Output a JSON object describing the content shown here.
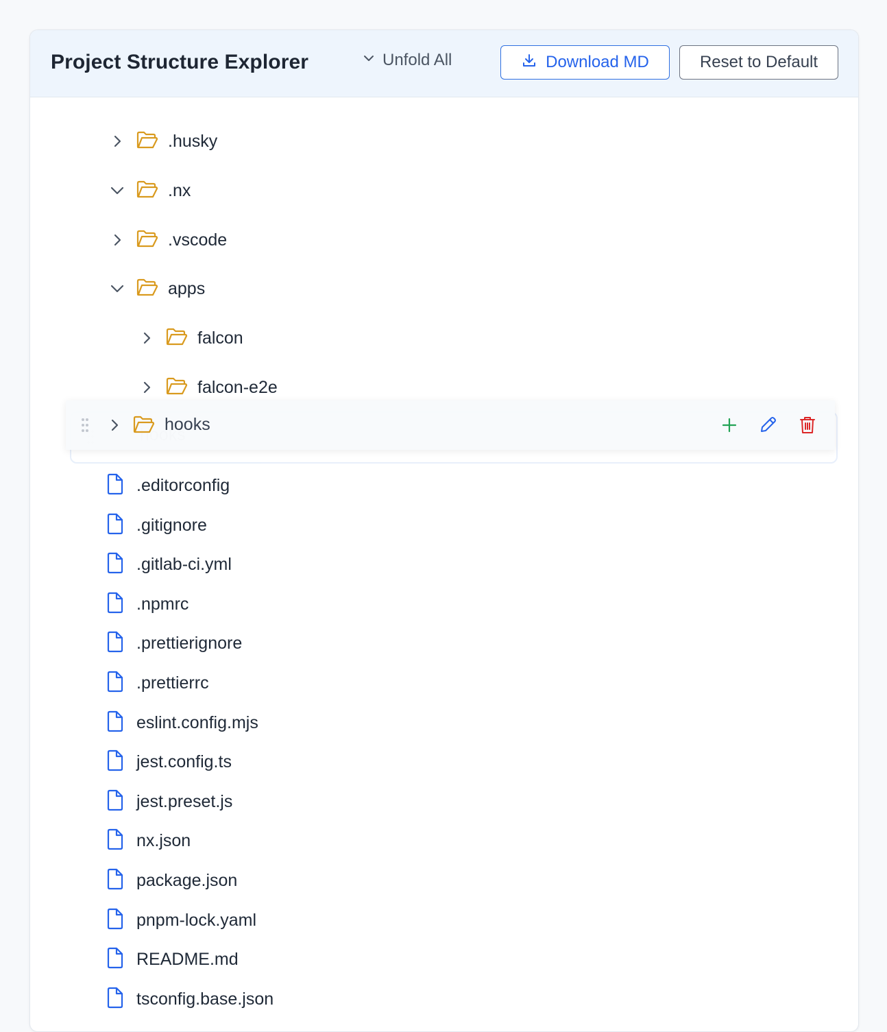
{
  "header": {
    "title": "Project Structure Explorer",
    "unfold_label": "Unfold All",
    "download_label": "Download MD",
    "reset_label": "Reset to Default"
  },
  "tree": {
    "folders": [
      {
        "name": ".husky",
        "expanded": false
      },
      {
        "name": ".nx",
        "expanded": true
      },
      {
        "name": ".vscode",
        "expanded": false
      },
      {
        "name": "apps",
        "expanded": true
      },
      {
        "name": "falcon",
        "expanded": false
      },
      {
        "name": "falcon-e2e",
        "expanded": false
      }
    ],
    "dragged": {
      "name": "hooks",
      "ghost_name": "hooks"
    },
    "files": [
      ".editorconfig",
      ".gitignore",
      ".gitlab-ci.yml",
      ".npmrc",
      ".prettierignore",
      ".prettierrc",
      "eslint.config.mjs",
      "jest.config.ts",
      "jest.preset.js",
      "nx.json",
      "package.json",
      "pnpm-lock.yaml",
      "README.md",
      "tsconfig.base.json"
    ]
  },
  "icons": {
    "folder": "folder-open-icon",
    "file": "file-icon",
    "chevron_right": "chevron-right-icon",
    "chevron_down": "chevron-down-icon",
    "drag": "drag-handle-icon",
    "add": "plus-icon",
    "edit": "pencil-icon",
    "delete": "trash-icon",
    "download": "download-icon"
  },
  "colors": {
    "folder": "#d99a1e",
    "file": "#2563eb",
    "add": "#22a355",
    "edit": "#2563eb",
    "delete": "#dc2626",
    "header_bg": "#eef5fd"
  }
}
